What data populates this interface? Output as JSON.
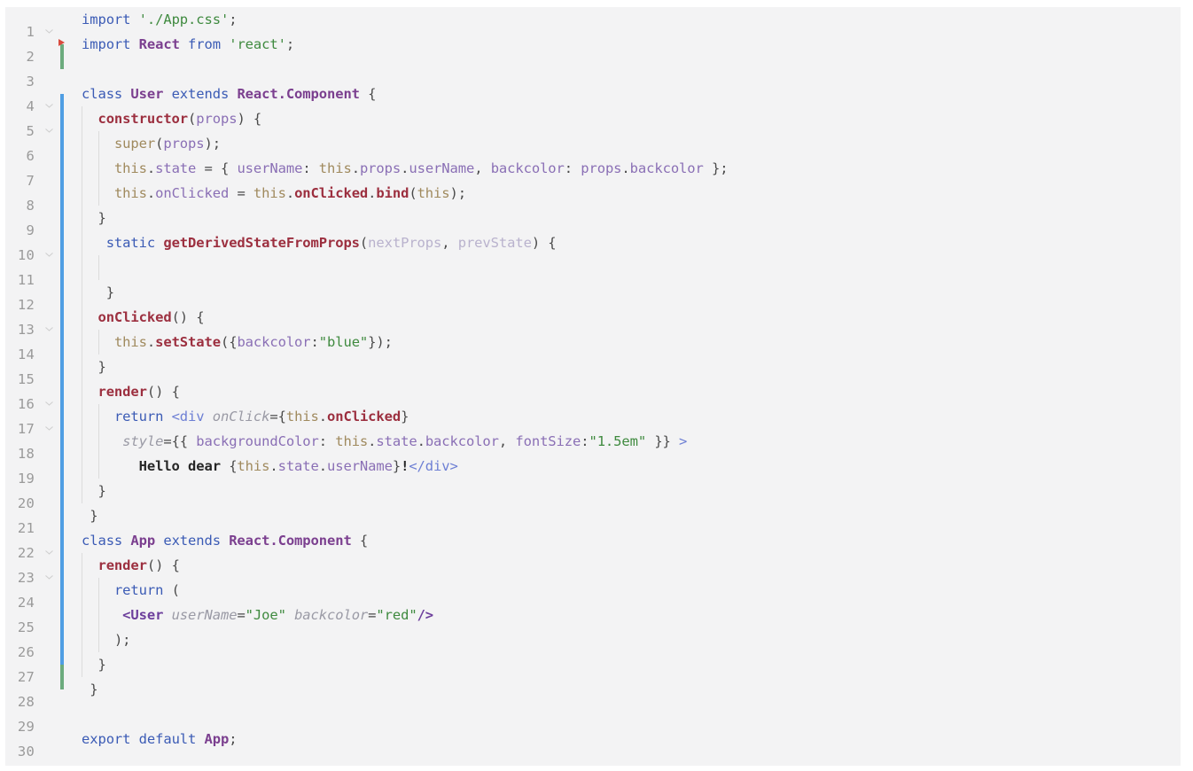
{
  "editor": {
    "kind": "code-editor",
    "language": "JavaScript JSX",
    "background_color": "#f3f3f4",
    "gutter_background_color": "#f3f3f4",
    "line_number_color": "#9a9a9a",
    "total_lines": 30,
    "first_visible_line": 1,
    "last_visible_line": 30
  },
  "theme_colors": {
    "keyword": "#3b5bb5",
    "string": "#3f8a3f",
    "class_name": "#7b3f8f",
    "function_name": "#9c2f3f",
    "this_keyword": "#a08a5e",
    "property": "#8a6fb5",
    "unused_param": "#b9b2cd",
    "jsx_tag": "#6d7fd4",
    "jsx_component": "#6d3f9c",
    "jsx_attribute": "#9a9aa5",
    "plain_text": "#3d3d3d",
    "vcs_added_marker": "#6cab7d",
    "vcs_modified_marker": "#4f9ee3",
    "caret_marker": "#d94a3d",
    "indent_guide": "#dcdcdc"
  },
  "gutter": {
    "line_numbers": [
      "1",
      "2",
      "3",
      "4",
      "5",
      "6",
      "7",
      "8",
      "9",
      "10",
      "11",
      "12",
      "13",
      "14",
      "15",
      "16",
      "17",
      "18",
      "19",
      "20",
      "21",
      "22",
      "23",
      "24",
      "25",
      "26",
      "27",
      "28",
      "29",
      "30"
    ],
    "fold_markers_on_lines": [
      1,
      4,
      5,
      10,
      13,
      16,
      17,
      22,
      23
    ],
    "vcs_markers": [
      {
        "type": "added",
        "color": "#6cab7d",
        "from_line": 2,
        "to_line": 2
      },
      {
        "type": "modified",
        "color": "#4f9ee3",
        "from_line": 4,
        "to_line": 26
      },
      {
        "type": "added",
        "color": "#6cab7d",
        "from_line": 27,
        "to_line": 27
      }
    ],
    "caret_marker_line": 2
  },
  "code_lines": [
    {
      "n": "1",
      "text": "import './App.css';"
    },
    {
      "n": "2",
      "text": "import React from 'react';"
    },
    {
      "n": "3",
      "text": ""
    },
    {
      "n": "4",
      "text": "class User extends React.Component {"
    },
    {
      "n": "5",
      "text": "  constructor(props) {"
    },
    {
      "n": "6",
      "text": "    super(props);"
    },
    {
      "n": "7",
      "text": "    this.state = { userName: this.props.userName, backcolor: props.backcolor };"
    },
    {
      "n": "8",
      "text": "    this.onClicked = this.onClicked.bind(this);"
    },
    {
      "n": "9",
      "text": "  }"
    },
    {
      "n": "10",
      "text": "   static getDerivedStateFromProps(nextProps, prevState) {"
    },
    {
      "n": "11",
      "text": ""
    },
    {
      "n": "12",
      "text": "   }"
    },
    {
      "n": "13",
      "text": "  onClicked() {"
    },
    {
      "n": "14",
      "text": "    this.setState({backcolor:\"blue\"});"
    },
    {
      "n": "15",
      "text": "  }"
    },
    {
      "n": "16",
      "text": "  render() {"
    },
    {
      "n": "17",
      "text": "    return <div onClick={this.onClicked}"
    },
    {
      "n": "18",
      "text": "     style={{ backgroundColor: this.state.backcolor, fontSize:\"1.5em\" }} >"
    },
    {
      "n": "19",
      "text": "       Hello dear {this.state.userName}!</div>"
    },
    {
      "n": "20",
      "text": "  }"
    },
    {
      "n": "21",
      "text": " }"
    },
    {
      "n": "22",
      "text": "class App extends React.Component {"
    },
    {
      "n": "23",
      "text": "  render() {"
    },
    {
      "n": "24",
      "text": "    return ("
    },
    {
      "n": "25",
      "text": "     <User userName=\"Joe\" backcolor=\"red\"/>"
    },
    {
      "n": "26",
      "text": "    );"
    },
    {
      "n": "27",
      "text": "  }"
    },
    {
      "n": "28",
      "text": " }"
    },
    {
      "n": "29",
      "text": ""
    },
    {
      "n": "30",
      "text": "export default App;"
    }
  ]
}
